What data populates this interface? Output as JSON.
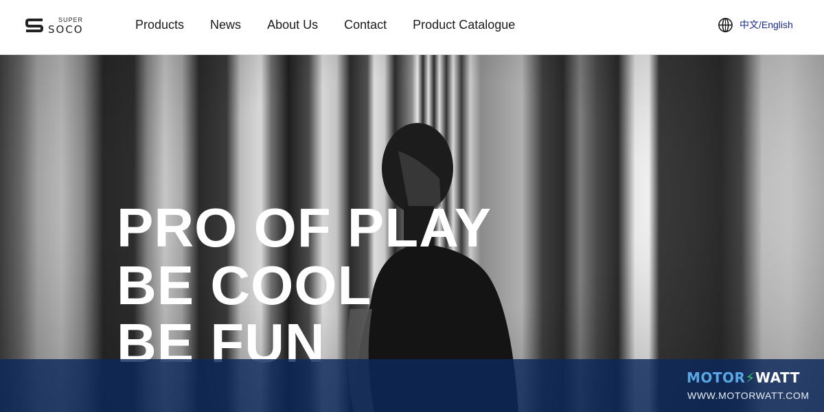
{
  "brand": {
    "logo_super": "SUPER",
    "logo_soco": "SOCO"
  },
  "nav": {
    "items": [
      {
        "label": "Products"
      },
      {
        "label": "News"
      },
      {
        "label": "About Us"
      },
      {
        "label": "Contact"
      },
      {
        "label": "Product Catalogue"
      }
    ]
  },
  "language": {
    "icon": "globe-icon",
    "label": "中文/English",
    "color": "#1a2a8a"
  },
  "hero": {
    "lines": [
      "PRO OF PLAY",
      "BE COOL",
      "BE FUN"
    ],
    "text_color": "#ffffff"
  },
  "watermark": {
    "brand_left": "MOTOR",
    "brand_right": "WATT",
    "url": "WWW.MOTORWATT.COM",
    "band_color": "#0c2a5c"
  }
}
